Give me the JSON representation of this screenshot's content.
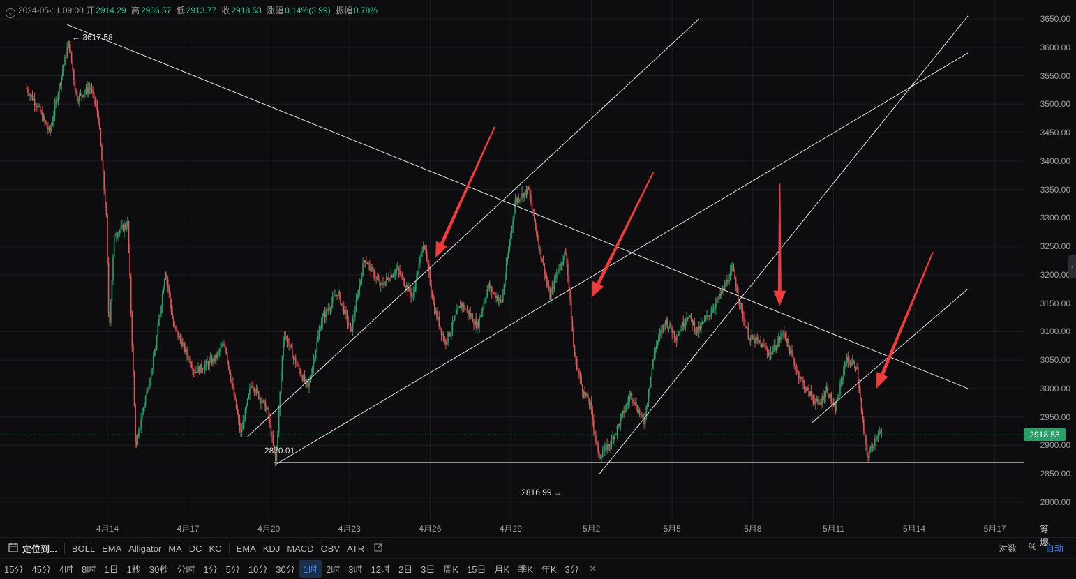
{
  "ohlc": {
    "datetime": "2024-05-11 09:00",
    "open_label": "开",
    "open": "2914.29",
    "high_label": "高",
    "high": "2936.57",
    "low_label": "低",
    "low": "2913.77",
    "close_label": "收",
    "close": "2918.53",
    "change_label": "涨幅",
    "change": "0.14%(3.99)",
    "amplitude_label": "振幅",
    "amplitude": "0.78%"
  },
  "last_price": "2918.53",
  "annotations": {
    "high": "3617.58",
    "low": "2816.99",
    "support": "2870.01"
  },
  "axis_corner": "筹 爆",
  "indicator_bar": {
    "locate": "定位到...",
    "overlays": [
      "BOLL",
      "EMA",
      "Alligator",
      "MA",
      "DC",
      "KC"
    ],
    "oscillators": [
      "EMA",
      "KDJ",
      "MACD",
      "OBV",
      "ATR"
    ],
    "log_label": "对数",
    "percent_label": "%",
    "auto_label": "自动"
  },
  "intervals": [
    "15分",
    "45分",
    "4时",
    "8时",
    "1日",
    "1秒",
    "30秒",
    "分时",
    "1分",
    "5分",
    "10分",
    "30分",
    "1时",
    "2时",
    "3时",
    "12时",
    "2日",
    "3日",
    "周K",
    "15日",
    "月K",
    "季K",
    "年K",
    "3分"
  ],
  "active_interval": "1时",
  "colors": {
    "up": "#26a269",
    "down": "#e05555",
    "arrow": "#f23a3a",
    "trendline": "#e6e6e6",
    "last_price": "#26a269"
  },
  "chart_data": {
    "type": "candlestick",
    "symbol_timeframe": "1H",
    "price_ticks": [
      "3650.00",
      "3600.00",
      "3550.00",
      "3500.00",
      "3450.00",
      "3400.00",
      "3350.00",
      "3300.00",
      "3250.00",
      "3200.00",
      "3150.00",
      "3100.00",
      "3050.00",
      "3000.00",
      "2950.00",
      "2900.00",
      "2850.00",
      "2800.00"
    ],
    "ylim": [
      2780,
      3670
    ],
    "date_ticks": [
      "4月14",
      "4月17",
      "4月20",
      "4月23",
      "4月26",
      "4月29",
      "5月2",
      "5月5",
      "5月8",
      "5月11",
      "5月14",
      "5月17"
    ],
    "day_range": [
      0,
      35
    ],
    "last": 2918.53,
    "extremes": [
      {
        "label": "3617.58",
        "day": 1.6,
        "price": 3617.58
      },
      {
        "label": "2816.99",
        "day": 19.9,
        "price": 2816.99
      }
    ],
    "horizontal_support": {
      "label": "2870.01",
      "price": 2870.01,
      "from_day": 9.2
    },
    "price_path": [
      [
        0,
        3530
      ],
      [
        0.4,
        3500
      ],
      [
        0.9,
        3450
      ],
      [
        1.2,
        3520
      ],
      [
        1.6,
        3610
      ],
      [
        1.9,
        3510
      ],
      [
        2.4,
        3530
      ],
      [
        2.7,
        3480
      ],
      [
        3.0,
        3300
      ],
      [
        3.1,
        3100
      ],
      [
        3.3,
        3270
      ],
      [
        3.8,
        3290
      ],
      [
        4.1,
        2890
      ],
      [
        4.3,
        2950
      ],
      [
        4.8,
        3060
      ],
      [
        5.2,
        3210
      ],
      [
        5.5,
        3110
      ],
      [
        5.9,
        3070
      ],
      [
        6.3,
        3030
      ],
      [
        7.0,
        3050
      ],
      [
        7.4,
        3080
      ],
      [
        8.0,
        2920
      ],
      [
        8.4,
        3010
      ],
      [
        9.0,
        2960
      ],
      [
        9.3,
        2870
      ],
      [
        9.6,
        3100
      ],
      [
        10.0,
        3050
      ],
      [
        10.5,
        3000
      ],
      [
        11.0,
        3120
      ],
      [
        11.6,
        3170
      ],
      [
        12.1,
        3100
      ],
      [
        12.6,
        3230
      ],
      [
        13.2,
        3180
      ],
      [
        13.8,
        3210
      ],
      [
        14.4,
        3160
      ],
      [
        14.8,
        3260
      ],
      [
        15.2,
        3140
      ],
      [
        15.6,
        3080
      ],
      [
        16.2,
        3150
      ],
      [
        16.8,
        3110
      ],
      [
        17.2,
        3180
      ],
      [
        17.7,
        3150
      ],
      [
        18.2,
        3330
      ],
      [
        18.7,
        3350
      ],
      [
        19.1,
        3250
      ],
      [
        19.5,
        3160
      ],
      [
        19.8,
        3210
      ],
      [
        20.1,
        3240
      ],
      [
        20.4,
        3060
      ],
      [
        20.7,
        3000
      ],
      [
        21.0,
        2970
      ],
      [
        21.3,
        2880
      ],
      [
        21.7,
        2900
      ],
      [
        22.0,
        2930
      ],
      [
        22.5,
        2990
      ],
      [
        23.0,
        2940
      ],
      [
        23.4,
        3070
      ],
      [
        23.8,
        3120
      ],
      [
        24.2,
        3090
      ],
      [
        24.6,
        3130
      ],
      [
        25.0,
        3100
      ],
      [
        25.4,
        3130
      ],
      [
        25.8,
        3160
      ],
      [
        26.3,
        3210
      ],
      [
        26.6,
        3140
      ],
      [
        26.9,
        3090
      ],
      [
        27.3,
        3080
      ],
      [
        27.7,
        3060
      ],
      [
        28.2,
        3100
      ],
      [
        28.6,
        3040
      ],
      [
        29.0,
        3000
      ],
      [
        29.5,
        2970
      ],
      [
        29.8,
        3000
      ],
      [
        30.1,
        2960
      ],
      [
        30.5,
        3050
      ],
      [
        30.9,
        3040
      ],
      [
        31.1,
        2950
      ],
      [
        31.3,
        2880
      ],
      [
        31.5,
        2900
      ],
      [
        31.7,
        2925
      ],
      [
        31.8,
        2918.53
      ]
    ],
    "trendlines": [
      {
        "points": [
          [
            1.5,
            3640
          ],
          [
            35,
            3000
          ]
        ]
      },
      {
        "points": [
          [
            8.2,
            2915
          ],
          [
            25.0,
            3650
          ]
        ]
      },
      {
        "points": [
          [
            9.2,
            2865
          ],
          [
            35,
            3590
          ]
        ]
      },
      {
        "points": [
          [
            21.3,
            2850
          ],
          [
            35,
            3655
          ]
        ]
      },
      {
        "points": [
          [
            29.2,
            2940
          ],
          [
            35,
            3175
          ]
        ]
      }
    ],
    "arrows": [
      {
        "from": [
          17.4,
          3460
        ],
        "to": [
          15.2,
          3230
        ]
      },
      {
        "from": [
          23.3,
          3380
        ],
        "to": [
          21.0,
          3160
        ]
      },
      {
        "from": [
          28.0,
          3360
        ],
        "to": [
          28.0,
          3145
        ]
      },
      {
        "from": [
          33.7,
          3240
        ],
        "to": [
          31.6,
          3000
        ]
      }
    ]
  }
}
